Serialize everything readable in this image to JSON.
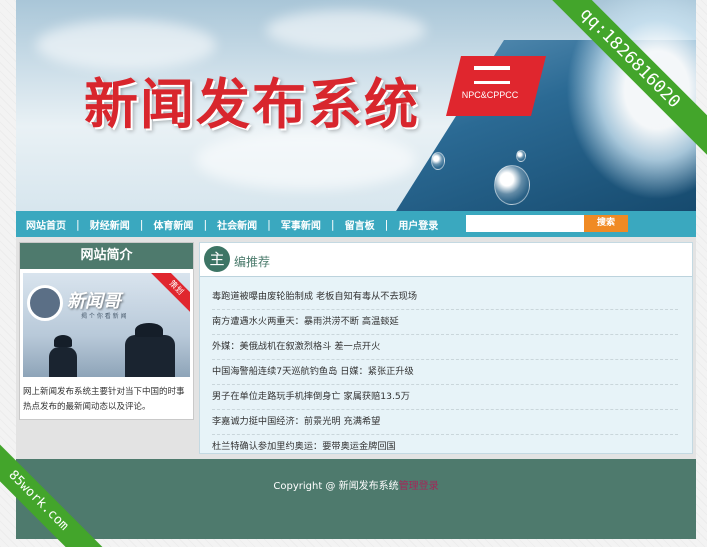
{
  "banner": {
    "title": "新闻发布系统",
    "badge_text": "NPC&CPPCC"
  },
  "nav": {
    "items": [
      "网站首页",
      "财经新闻",
      "体育新闻",
      "社会新闻",
      "军事新闻",
      "留言板",
      "用户登录"
    ],
    "search_placeholder": "",
    "search_button": "搜索"
  },
  "sidebar": {
    "title": "网站简介",
    "photo_logo": "新闻哥",
    "photo_sub": "揭 个 你 看 新 闻",
    "photo_ribbon": "策划",
    "description": "网上新闻发布系统主要针对当下中国的时事热点发布的最新闻动态以及评论。"
  },
  "main": {
    "badge": "主",
    "title": "编推荐",
    "news": [
      "毒跑道被曝由废轮胎制成 老板自知有毒从不去现场",
      "南方遭遇水火两重天：暴雨洪涝不断 高温燅延",
      "外媒：美俄战机在叙激烈格斗 差一点开火",
      "中国海警船连续7天巡航钓鱼岛 日媒：紧张正升级",
      "男子在单位走路玩手机摔倒身亡 家属获赔13.5万",
      "李嘉诚力挺中国经济：前景光明 充满希望",
      "杜兰特确认参加里约奥运：要带奥运金牌回国"
    ]
  },
  "footer": {
    "copyright": "Copyright @ 新闻发布系统",
    "admin_link": "管理登录"
  },
  "watermarks": {
    "top_right": "qq:1826816020",
    "bottom_left": "85work.com"
  },
  "colors": {
    "nav_bg": "#3aa8bf",
    "dark_green": "#4e7a6d",
    "search_button": "#f08a24",
    "title_red": "#d8262d",
    "ribbon_green": "#43a52b"
  }
}
